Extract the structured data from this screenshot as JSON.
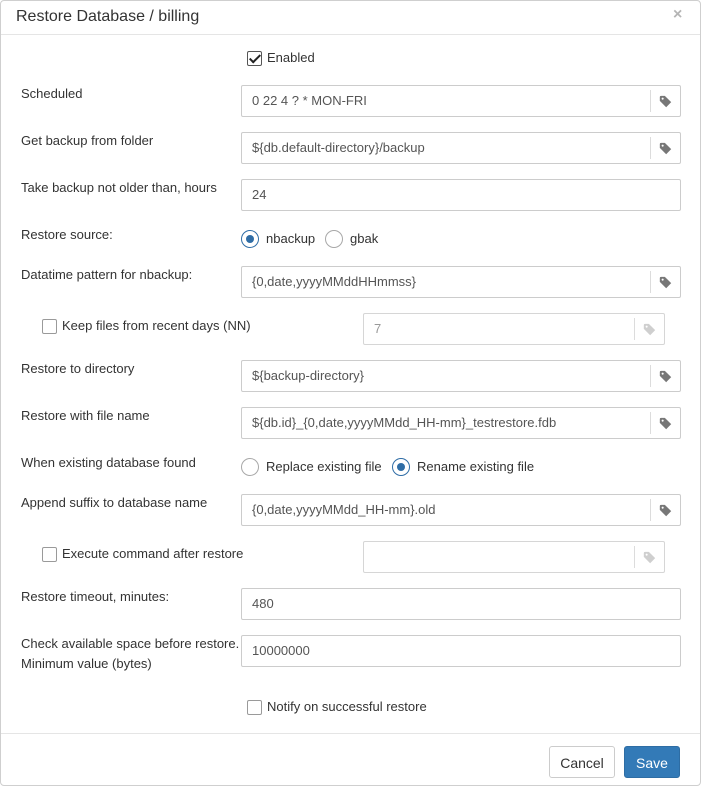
{
  "dialog": {
    "title": "Restore Database / billing",
    "close_glyph": "×"
  },
  "enabled": {
    "label": "Enabled",
    "checked": true
  },
  "fields": {
    "scheduled": {
      "label": "Scheduled",
      "value": "0 22 4 ? * MON-FRI"
    },
    "backup_folder": {
      "label": "Get backup from folder",
      "value": "${db.default-directory}/backup"
    },
    "max_age": {
      "label": "Take backup not older than, hours",
      "value": "24"
    },
    "datetime_pattern": {
      "label": "Datatime pattern for nbackup:",
      "value": "{0,date,yyyyMMddHHmmss}"
    },
    "keep_files": {
      "label": "Keep files from recent days (NN)",
      "checked": false,
      "value": "7"
    },
    "restore_dir": {
      "label": "Restore to directory",
      "value": "${backup-directory}"
    },
    "restore_file": {
      "label": "Restore with file name",
      "value": "${db.id}_{0,date,yyyyMMdd_HH-mm}_testrestore.fdb"
    },
    "suffix": {
      "label": "Append suffix to database name",
      "value": "{0,date,yyyyMMdd_HH-mm}.old"
    },
    "exec_cmd": {
      "label": "Execute command after restore",
      "checked": false,
      "value": ""
    },
    "timeout": {
      "label": "Restore timeout, minutes:",
      "value": "480"
    },
    "space": {
      "label_line1": "Check available space before restore.",
      "label_line2": "Minimum value (bytes)",
      "value": "10000000"
    }
  },
  "restore_source": {
    "label": "Restore source:",
    "options": [
      "nbackup",
      "gbak"
    ],
    "selected": "nbackup"
  },
  "existing_db": {
    "label": "When existing database found",
    "options": [
      "Replace existing file",
      "Rename existing file"
    ],
    "selected": "Rename existing file"
  },
  "notify": {
    "label": "Notify on successful restore",
    "checked": false
  },
  "footer": {
    "cancel_label": "Cancel",
    "save_label": "Save"
  },
  "icons": {
    "tag": "tag-icon"
  },
  "colors": {
    "primary": "#337ab7",
    "radio_on": "#2f6da6"
  }
}
